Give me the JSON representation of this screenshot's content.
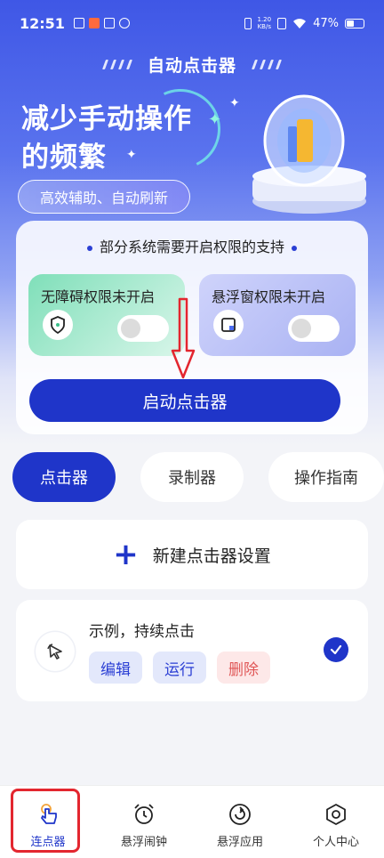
{
  "status_bar": {
    "time": "12:51",
    "net_speed_value": "1.20",
    "net_speed_unit": "KB/s",
    "battery": "47%"
  },
  "header": {
    "app_title": "自动点击器",
    "hero_line1": "减少手动操作",
    "hero_line2": "的频繁",
    "hero_tag": "高效辅助、自动刷新"
  },
  "permissions": {
    "notice": "部分系统需要开启权限的支持",
    "accessibility_label": "无障碍权限未开启",
    "floating_window_label": "悬浮窗权限未开启",
    "start_button": "启动点击器"
  },
  "tabs": [
    {
      "label": "点击器",
      "active": true
    },
    {
      "label": "录制器",
      "active": false
    },
    {
      "label": "操作指南",
      "active": false
    }
  ],
  "new_setting": {
    "plus": "+",
    "label": "新建点击器设置"
  },
  "example": {
    "title": "示例，持续点击",
    "edit": "编辑",
    "run": "运行",
    "delete": "删除"
  },
  "bottom_nav": [
    {
      "label": "连点器",
      "icon": "tap-hand-icon"
    },
    {
      "label": "悬浮闹钟",
      "icon": "alarm-clock-icon"
    },
    {
      "label": "悬浮应用",
      "icon": "refresh-circle-icon"
    },
    {
      "label": "个人中心",
      "icon": "hexagon-gear-icon"
    }
  ],
  "colors": {
    "primary": "#1f35c9",
    "danger": "#e05757",
    "annotation_red": "#e3262f"
  }
}
